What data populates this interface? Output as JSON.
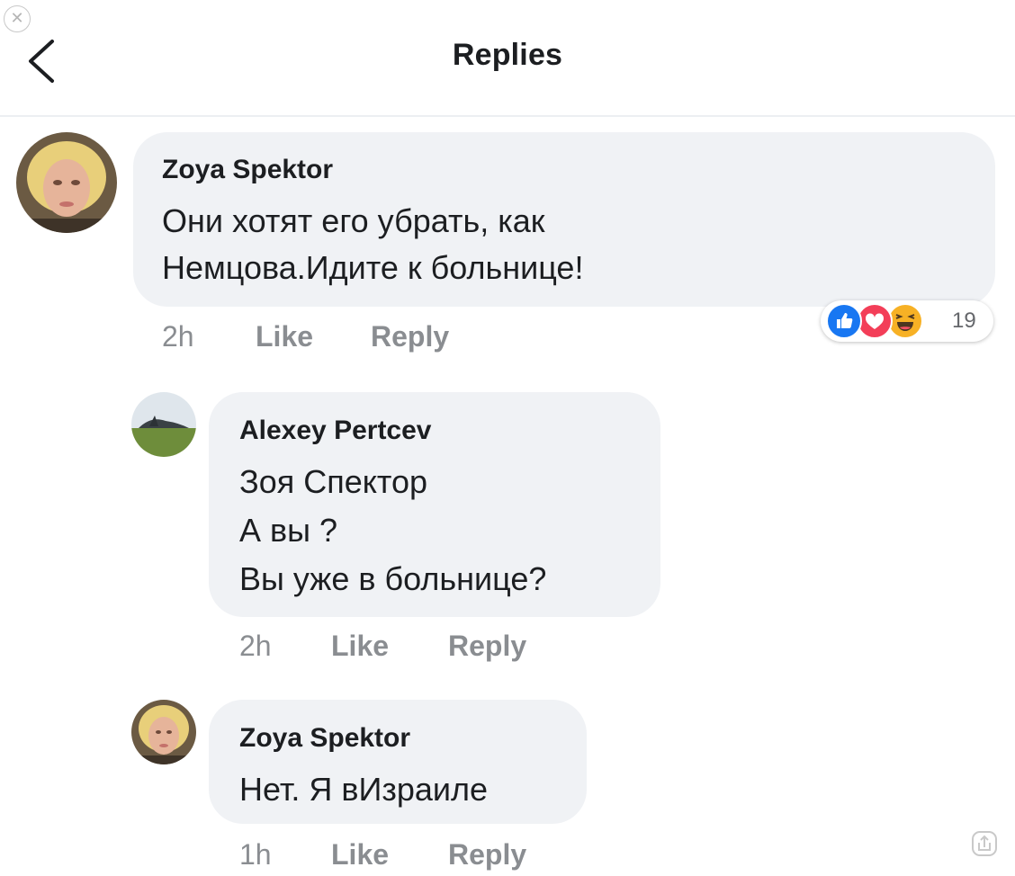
{
  "header": {
    "title": "Replies",
    "back_icon": "chevron-left-icon",
    "close_icon": "close-circle-icon"
  },
  "comments": [
    {
      "author": "Zoya Spektor",
      "lines": [
        "Они хотят его убрать, как",
        "Немцова.Идите к больнице!"
      ],
      "time": "2h",
      "like_label": "Like",
      "reply_label": "Reply",
      "reactions": {
        "icons": [
          "like-reaction-icon",
          "love-reaction-icon",
          "haha-reaction-icon"
        ],
        "count": "19"
      }
    },
    {
      "author": "Alexey Pertcev",
      "lines": [
        "Зоя Спектор",
        "А вы ?",
        "Вы уже в больнице?"
      ],
      "time": "2h",
      "like_label": "Like",
      "reply_label": "Reply"
    },
    {
      "author": "Zoya Spektor",
      "lines": [
        "Нет. Я вИзраиле"
      ],
      "time": "1h",
      "like_label": "Like",
      "reply_label": "Reply"
    }
  ],
  "colors": {
    "bubble": "#f0f2f5",
    "meta_text": "#8a8d91",
    "like_blue": "#1877f2",
    "love_red": "#f33e58",
    "haha_yellow": "#f7b125"
  }
}
